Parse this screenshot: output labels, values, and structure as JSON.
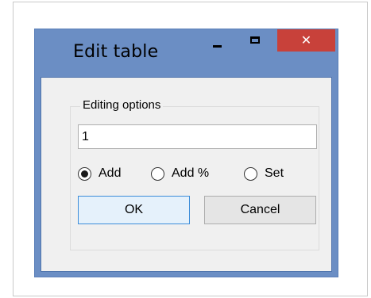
{
  "window": {
    "title": "Edit table",
    "close_glyph": "✕"
  },
  "group": {
    "legend": "Editing options"
  },
  "input": {
    "value": "1"
  },
  "radios": [
    {
      "label": "Add",
      "checked": true
    },
    {
      "label": "Add %",
      "checked": false
    },
    {
      "label": "Set",
      "checked": false
    }
  ],
  "buttons": {
    "ok_label": "OK",
    "cancel_label": "Cancel"
  },
  "colors": {
    "titlebar": "#6b8ec4",
    "close_button": "#c8413a",
    "client_bg": "#f0f0f0",
    "ok_border": "#3c8cd9"
  },
  "icons": {
    "minimize": "minimize-icon",
    "maximize": "maximize-icon",
    "close": "close-icon"
  }
}
